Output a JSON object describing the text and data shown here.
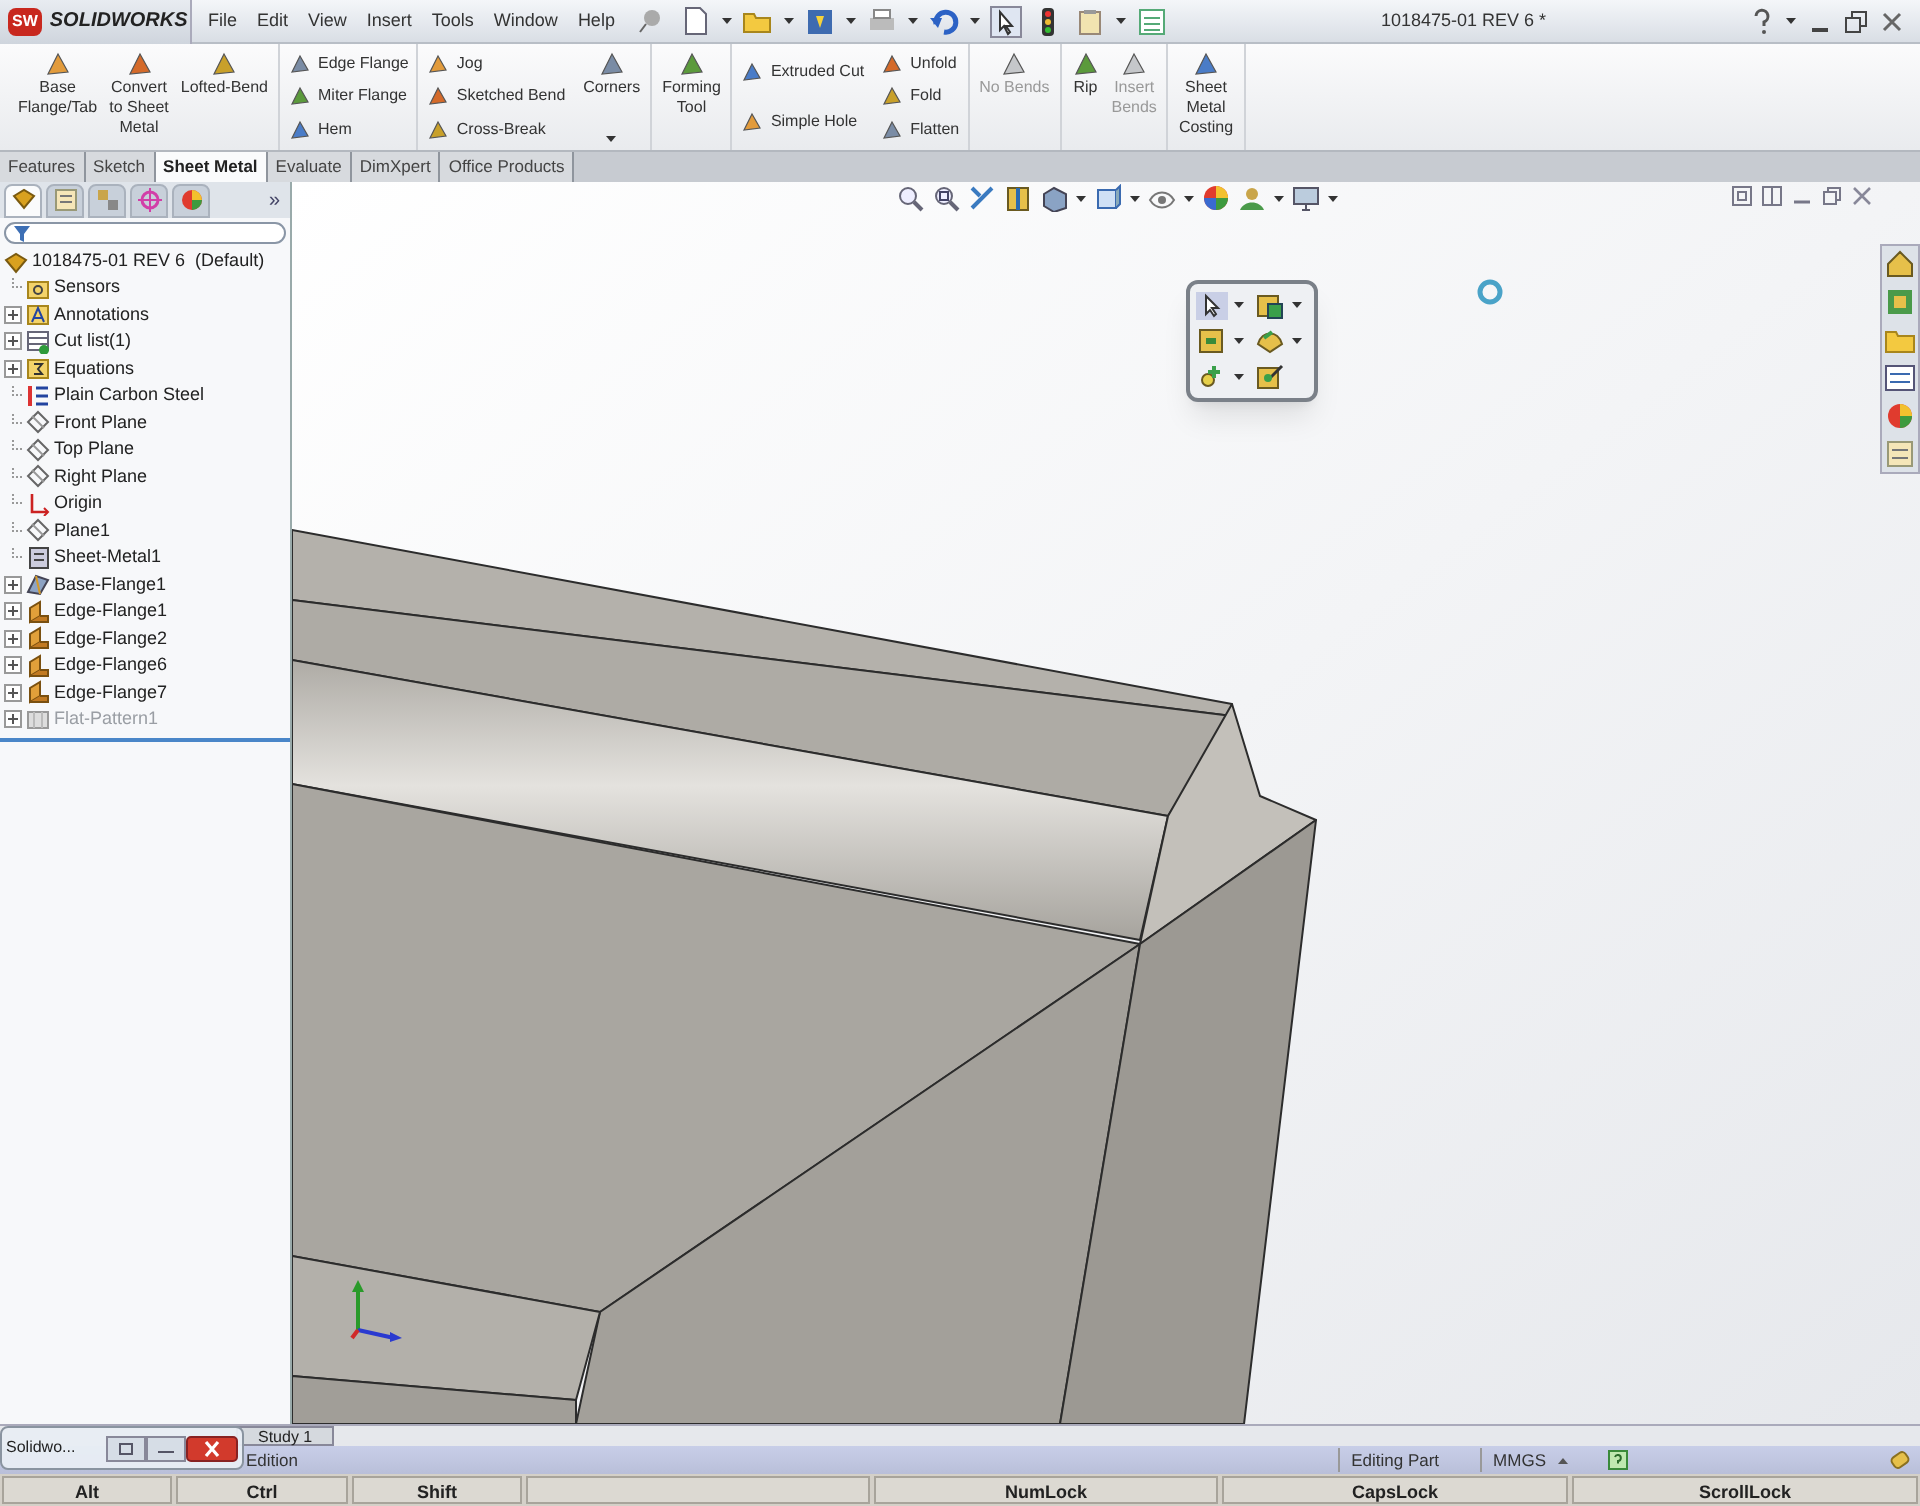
{
  "title_bar": {
    "logo": {
      "mark": "SW",
      "text": "SOLIDWORKS"
    },
    "menus": [
      "File",
      "Edit",
      "View",
      "Insert",
      "Tools",
      "Window",
      "Help"
    ],
    "document_title": "1018475-01 REV 6 *"
  },
  "ribbon": [
    {
      "kind": "large",
      "buttons": [
        {
          "lines": [
            "Base",
            "Flange/Tab"
          ],
          "disabled": false
        },
        {
          "lines": [
            "Convert",
            "to Sheet",
            "Metal"
          ],
          "disabled": false
        },
        {
          "lines": [
            "Lofted-Bend"
          ],
          "disabled": false
        }
      ]
    },
    {
      "kind": "column",
      "buttons": [
        {
          "lines": [
            "Edge Flange"
          ],
          "disabled": false
        },
        {
          "lines": [
            "Miter Flange"
          ],
          "disabled": false
        },
        {
          "lines": [
            "Hem"
          ],
          "disabled": false
        }
      ]
    },
    {
      "kind": "column",
      "buttons": [
        {
          "lines": [
            "Jog"
          ],
          "disabled": false
        },
        {
          "lines": [
            "Sketched Bend"
          ],
          "disabled": false
        },
        {
          "lines": [
            "Cross-Break"
          ],
          "disabled": false
        }
      ]
    },
    {
      "kind": "dropdown",
      "buttons": [
        {
          "lines": [
            "Corners"
          ],
          "disabled": false
        }
      ]
    },
    {
      "kind": "large",
      "buttons": [
        {
          "lines": [
            "Forming",
            "Tool"
          ],
          "disabled": false
        }
      ]
    },
    {
      "kind": "column",
      "buttons": [
        {
          "lines": [
            "Extruded Cut"
          ],
          "disabled": false
        },
        {
          "lines": [
            "Simple Hole"
          ],
          "disabled": false
        }
      ]
    },
    {
      "kind": "column",
      "buttons": [
        {
          "lines": [
            "Unfold"
          ],
          "disabled": false
        },
        {
          "lines": [
            "Fold"
          ],
          "disabled": false
        },
        {
          "lines": [
            "Flatten"
          ],
          "disabled": false
        }
      ]
    },
    {
      "kind": "large",
      "buttons": [
        {
          "lines": [
            "No Bends"
          ],
          "disabled": true
        }
      ]
    },
    {
      "kind": "large",
      "buttons": [
        {
          "lines": [
            "Rip"
          ],
          "disabled": false
        },
        {
          "lines": [
            "Insert",
            "Bends"
          ],
          "disabled": true
        }
      ]
    },
    {
      "kind": "large",
      "buttons": [
        {
          "lines": [
            "Sheet",
            "Metal",
            "Costing"
          ],
          "disabled": false
        }
      ]
    }
  ],
  "command_tabs": [
    {
      "label": "Features",
      "selected": false
    },
    {
      "label": "Sketch",
      "selected": false
    },
    {
      "label": "Sheet Metal",
      "selected": true
    },
    {
      "label": "Evaluate",
      "selected": false
    },
    {
      "label": "DimXpert",
      "selected": false
    },
    {
      "label": "Office Products",
      "selected": false
    }
  ],
  "feature_manager": {
    "panel_tabs": [
      {
        "kind": "tree",
        "selected": true
      },
      {
        "kind": "properties",
        "selected": false
      },
      {
        "kind": "configurations",
        "selected": false
      },
      {
        "kind": "dimxpert",
        "selected": false
      },
      {
        "kind": "display",
        "selected": false
      }
    ],
    "more_tabs": "»",
    "tree": {
      "root": "1018475-01 REV 6  (Default)",
      "children": [
        {
          "label": "Sensors",
          "kind": "sensors",
          "collapsed": false,
          "suppressed": false
        },
        {
          "label": "Annotations",
          "kind": "annotations",
          "collapsed": true,
          "suppressed": false
        },
        {
          "label": "Cut list(1)",
          "kind": "cutlist",
          "collapsed": true,
          "suppressed": false
        },
        {
          "label": "Equations",
          "kind": "equations",
          "collapsed": true,
          "suppressed": false
        },
        {
          "label": "Plain Carbon Steel",
          "kind": "material",
          "collapsed": false,
          "suppressed": false
        },
        {
          "label": "Front Plane",
          "kind": "plane",
          "collapsed": false,
          "suppressed": false
        },
        {
          "label": "Top Plane",
          "kind": "plane",
          "collapsed": false,
          "suppressed": false
        },
        {
          "label": "Right Plane",
          "kind": "plane",
          "collapsed": false,
          "suppressed": false
        },
        {
          "label": "Origin",
          "kind": "origin",
          "collapsed": false,
          "suppressed": false
        },
        {
          "label": "Plane1",
          "kind": "plane",
          "collapsed": false,
          "suppressed": false
        },
        {
          "label": "Sheet-Metal1",
          "kind": "sheetmetal",
          "collapsed": false,
          "suppressed": false
        },
        {
          "label": "Base-Flange1",
          "kind": "baseflange",
          "collapsed": true,
          "suppressed": false
        },
        {
          "label": "Edge-Flange1",
          "kind": "edgeflange",
          "collapsed": true,
          "suppressed": false
        },
        {
          "label": "Edge-Flange2",
          "kind": "edgeflange",
          "collapsed": true,
          "suppressed": false
        },
        {
          "label": "Edge-Flange6",
          "kind": "edgeflange",
          "collapsed": true,
          "suppressed": false
        },
        {
          "label": "Edge-Flange7",
          "kind": "edgeflange",
          "collapsed": true,
          "suppressed": false
        },
        {
          "label": "Flat-Pattern1",
          "kind": "flatpattern",
          "collapsed": true,
          "suppressed": true
        }
      ]
    }
  },
  "study_tab": "Study 1",
  "status_bar": {
    "left": "Edition",
    "mode": "Editing Part",
    "units": "MMGS"
  },
  "keys": [
    {
      "kind": "key",
      "label": "Alt"
    },
    {
      "kind": "key",
      "label": "Ctrl"
    },
    {
      "kind": "key",
      "label": "Shift"
    },
    {
      "kind": "blank"
    },
    {
      "kind": "key",
      "label": "NumLock"
    },
    {
      "kind": "key",
      "label": "CapsLock"
    },
    {
      "kind": "key",
      "label": "ScrollLock"
    }
  ],
  "taskbar_thumbnail": {
    "label": "Solidwo..."
  }
}
